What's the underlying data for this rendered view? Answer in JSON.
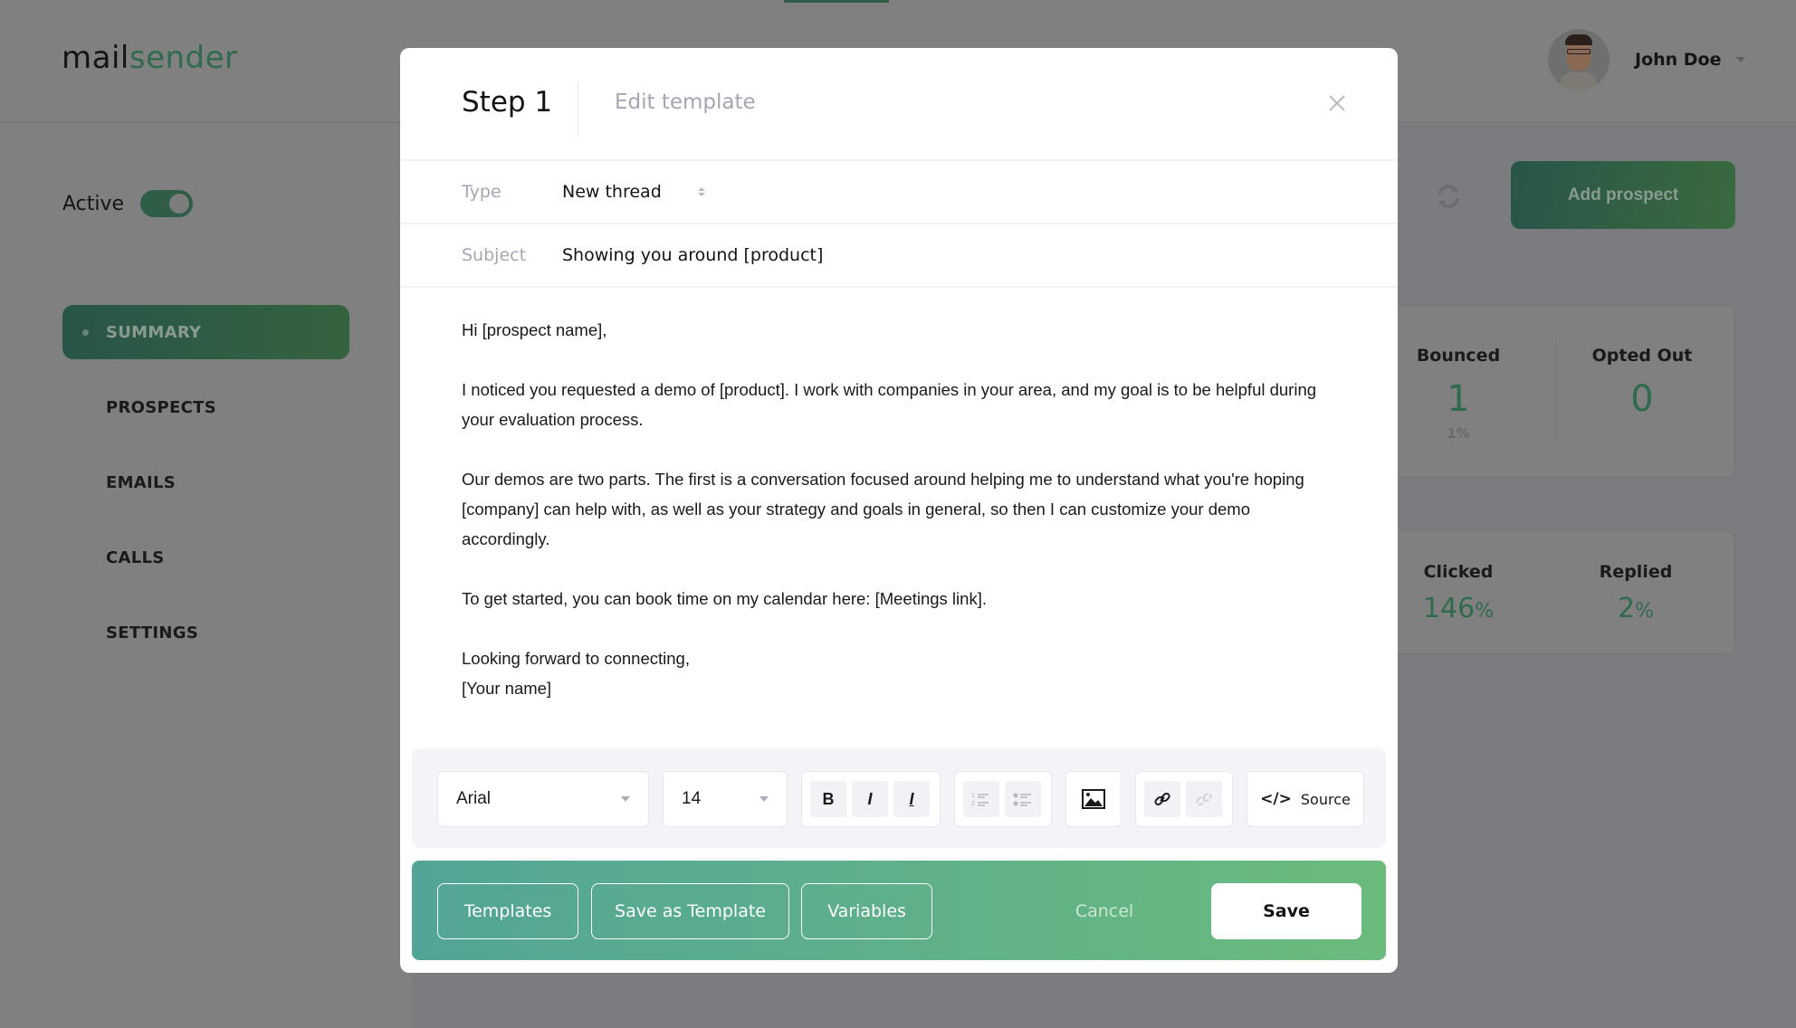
{
  "app": {
    "logo_part1": "mail",
    "logo_part2": "sender",
    "user_name": "John Doe",
    "brand_color": "#2f6b4c"
  },
  "sidebar": {
    "active_label": "Active",
    "active_toggle_on": true,
    "items": [
      {
        "label": "SUMMARY",
        "active": true
      },
      {
        "label": "PROSPECTS",
        "active": false
      },
      {
        "label": "EMAILS",
        "active": false
      },
      {
        "label": "CALLS",
        "active": false
      },
      {
        "label": "SETTINGS",
        "active": false
      }
    ]
  },
  "main": {
    "add_prospect_label": "Add prospect",
    "stats_row1": [
      {
        "label": "Bounced",
        "value": "1",
        "sub": "1%"
      },
      {
        "label": "Opted Out",
        "value": "0"
      }
    ],
    "stats_row2": [
      {
        "label": "Clicked",
        "value": "146",
        "unit": "%"
      },
      {
        "label": "Replied",
        "value": "2",
        "unit": "%"
      }
    ]
  },
  "modal": {
    "title": "Step 1",
    "subtitle": "Edit template",
    "type_label": "Type",
    "type_value": "New thread",
    "subject_label": "Subject",
    "subject_value": "Showing you around [product]",
    "body": {
      "p1": "Hi [prospect name],",
      "p2": "I noticed you requested a demo of [product]. I work with companies in your area, and my goal is to be helpful during your evaluation process.",
      "p3": "Our demos are two parts. The first is a conversation focused around helping me to understand what you're hoping [company] can help with, as well as your strategy and goals in general, so then I can customize your demo accordingly.",
      "p4": "To get started, you can book time on my calendar here: [Meetings link].",
      "p5": "Looking forward to connecting,",
      "p6": "[Your name]"
    },
    "toolbar": {
      "font": "Arial",
      "size": "14",
      "bold": "B",
      "italic": "I",
      "underline": "I",
      "source_code": "</>",
      "source_label": "Source"
    },
    "footer": {
      "templates": "Templates",
      "save_as_template": "Save as Template",
      "variables": "Variables",
      "cancel": "Cancel",
      "save": "Save"
    }
  }
}
